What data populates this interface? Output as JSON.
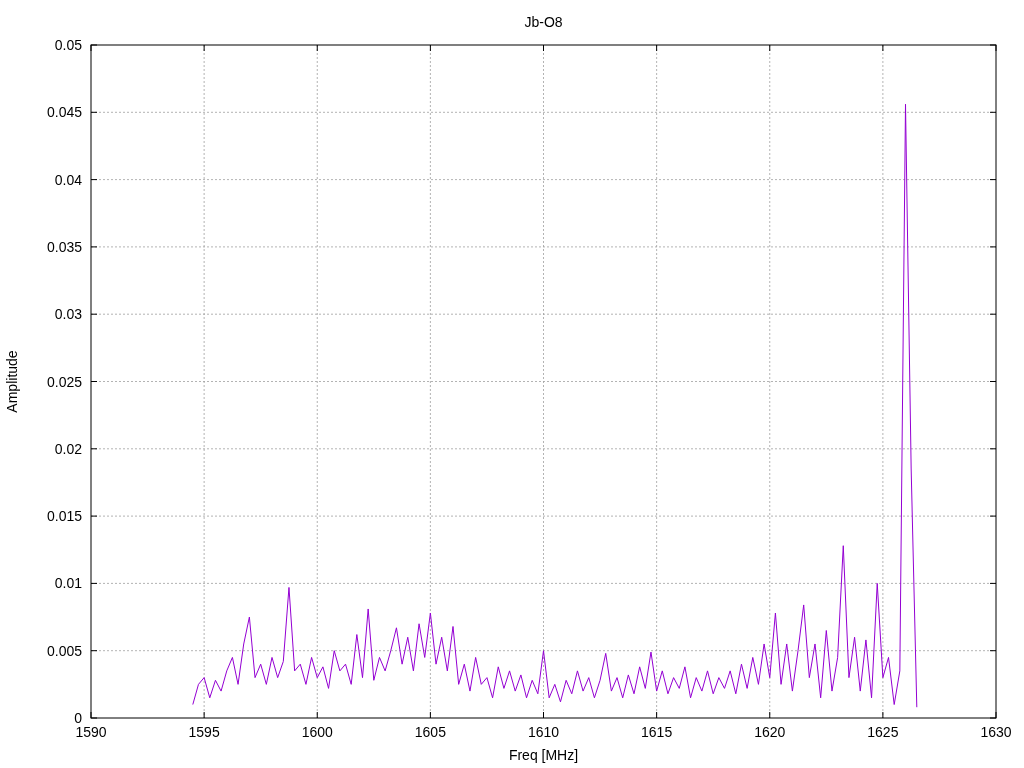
{
  "plot": {
    "chart_data": {
      "type": "line",
      "title": "Jb-O8",
      "xlabel": "Freq [MHz]",
      "ylabel": "Amplitude",
      "grid": true,
      "xlim": [
        1590,
        1630
      ],
      "ylim": [
        0,
        0.05
      ],
      "xticks": [
        1590,
        1595,
        1600,
        1605,
        1610,
        1615,
        1620,
        1625,
        1630
      ],
      "yticks": [
        {
          "value": 0,
          "label": "0"
        },
        {
          "value": 0.005,
          "label": "0.005"
        },
        {
          "value": 0.01,
          "label": "0.01"
        },
        {
          "value": 0.015,
          "label": "0.015"
        },
        {
          "value": 0.02,
          "label": "0.02"
        },
        {
          "value": 0.025,
          "label": "0.025"
        },
        {
          "value": 0.03,
          "label": "0.03"
        },
        {
          "value": 0.035,
          "label": "0.035"
        },
        {
          "value": 0.04,
          "label": "0.04"
        },
        {
          "value": 0.045,
          "label": "0.045"
        },
        {
          "value": 0.05,
          "label": "0.05"
        }
      ],
      "x": [
        1594.5,
        1594.75,
        1595,
        1595.25,
        1595.5,
        1595.75,
        1596,
        1596.25,
        1596.5,
        1596.75,
        1597,
        1597.25,
        1597.5,
        1597.75,
        1598,
        1598.25,
        1598.5,
        1598.75,
        1599,
        1599.25,
        1599.5,
        1599.75,
        1600,
        1600.25,
        1600.5,
        1600.75,
        1601,
        1601.25,
        1601.5,
        1601.75,
        1602,
        1602.25,
        1602.5,
        1602.75,
        1603,
        1603.25,
        1603.5,
        1603.75,
        1604,
        1604.25,
        1604.5,
        1604.75,
        1605,
        1605.25,
        1605.5,
        1605.75,
        1606,
        1606.25,
        1606.5,
        1606.75,
        1607,
        1607.25,
        1607.5,
        1607.75,
        1608,
        1608.25,
        1608.5,
        1608.75,
        1609,
        1609.25,
        1609.5,
        1609.75,
        1610,
        1610.25,
        1610.5,
        1610.75,
        1611,
        1611.25,
        1611.5,
        1611.75,
        1612,
        1612.25,
        1612.5,
        1612.75,
        1613,
        1613.25,
        1613.5,
        1613.75,
        1614,
        1614.25,
        1614.5,
        1614.75,
        1615,
        1615.25,
        1615.5,
        1615.75,
        1616,
        1616.25,
        1616.5,
        1616.75,
        1617,
        1617.25,
        1617.5,
        1617.75,
        1618,
        1618.25,
        1618.5,
        1618.75,
        1619,
        1619.25,
        1619.5,
        1619.75,
        1620,
        1620.25,
        1620.5,
        1620.75,
        1621,
        1621.25,
        1621.5,
        1621.75,
        1622,
        1622.25,
        1622.5,
        1622.75,
        1623,
        1623.25,
        1623.5,
        1623.75,
        1624,
        1624.25,
        1624.5,
        1624.75,
        1625,
        1625.25,
        1625.5,
        1625.75,
        1626,
        1626.25,
        1626.5
      ],
      "series": [
        {
          "color": "#9400d3",
          "values": [
            0.001,
            0.0025,
            0.003,
            0.0015,
            0.0028,
            0.002,
            0.0035,
            0.0045,
            0.0025,
            0.0055,
            0.0075,
            0.003,
            0.004,
            0.0025,
            0.0045,
            0.003,
            0.0042,
            0.0097,
            0.0035,
            0.004,
            0.0025,
            0.0045,
            0.003,
            0.0038,
            0.0022,
            0.005,
            0.0035,
            0.004,
            0.0025,
            0.0062,
            0.003,
            0.0081,
            0.0028,
            0.0045,
            0.0035,
            0.005,
            0.0067,
            0.004,
            0.006,
            0.0035,
            0.007,
            0.0045,
            0.0078,
            0.004,
            0.006,
            0.0035,
            0.0068,
            0.0025,
            0.004,
            0.002,
            0.0045,
            0.0025,
            0.003,
            0.0015,
            0.0038,
            0.0022,
            0.0035,
            0.002,
            0.0032,
            0.0015,
            0.0028,
            0.0018,
            0.005,
            0.0015,
            0.0025,
            0.0012,
            0.0028,
            0.0018,
            0.0035,
            0.002,
            0.003,
            0.0015,
            0.0028,
            0.0048,
            0.002,
            0.003,
            0.0015,
            0.0032,
            0.0018,
            0.0038,
            0.0022,
            0.0049,
            0.002,
            0.0035,
            0.0018,
            0.003,
            0.0022,
            0.0038,
            0.0015,
            0.003,
            0.002,
            0.0035,
            0.0018,
            0.003,
            0.0022,
            0.0035,
            0.0018,
            0.004,
            0.0022,
            0.0045,
            0.0025,
            0.0055,
            0.003,
            0.0078,
            0.0025,
            0.0055,
            0.002,
            0.005,
            0.0084,
            0.003,
            0.0055,
            0.0015,
            0.0065,
            0.002,
            0.0045,
            0.0128,
            0.003,
            0.006,
            0.002,
            0.0058,
            0.0015,
            0.01,
            0.003,
            0.0045,
            0.001,
            0.0035,
            0.0456,
            0.0185,
            0.0008
          ]
        }
      ]
    }
  }
}
